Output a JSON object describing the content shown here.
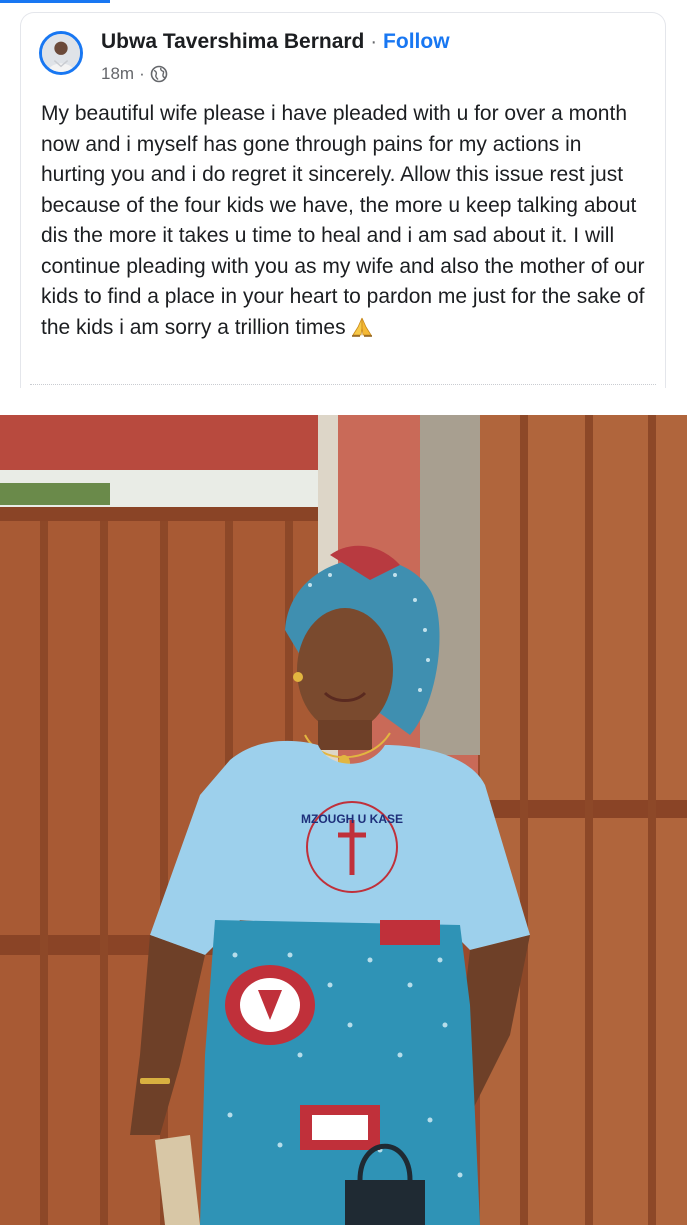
{
  "post": {
    "author": "Ubwa Tavershima Bernard",
    "separator": "·",
    "follow_label": "Follow",
    "timestamp": "18m",
    "meta_separator": "·",
    "audience_icon": "globe-icon",
    "text": "My beautiful wife please i have pleaded with u for over a month now and i myself has gone through pains for my actions in hurting you and i do regret it sincerely. Allow this issue rest just because of the four kids we have, the more u keep talking about dis the more it takes u time to heal and i am sad about it. I will continue pleading with you as my wife and also the mother of our kids to find a place in your heart to pardon me just for the sake of the kids i am sorry a trillion times",
    "emoji": "folded-hands-icon"
  },
  "photo": {
    "shirt_print": "MZOUGH U KASE"
  },
  "colors": {
    "accent": "#1877f2",
    "text": "#1c1e21",
    "secondary": "#65676b"
  }
}
